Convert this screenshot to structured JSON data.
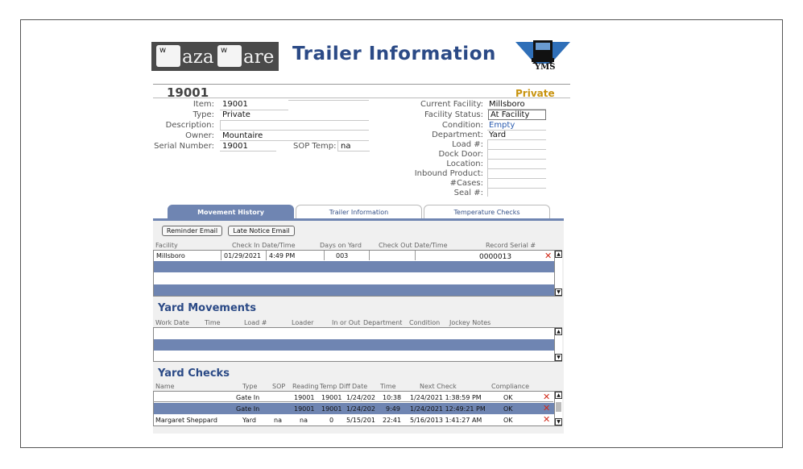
{
  "logo": {
    "key1": "w",
    "word1": "aza",
    "key2": "w",
    "word2": "are"
  },
  "header": {
    "title": "Trailer Information",
    "badge_text": "YMS"
  },
  "trailer": {
    "number": "19001",
    "category": "Private"
  },
  "left_fields": [
    {
      "label": "Item:",
      "value": "19001"
    },
    {
      "label": "Type:",
      "value": "Private"
    },
    {
      "label": "Description:",
      "value": ""
    },
    {
      "label": "Owner:",
      "value": "Mountaire"
    },
    {
      "label": "Serial Number:",
      "value": "19001"
    }
  ],
  "sop_temp": {
    "label": "SOP Temp:",
    "value": "na"
  },
  "right_fields": [
    {
      "label": "Current Facility:",
      "value": "Millsboro"
    },
    {
      "label": "Facility Status:",
      "value": "At Facility"
    },
    {
      "label": "Condition:",
      "value": "Empty"
    },
    {
      "label": "Department:",
      "value": "Yard"
    },
    {
      "label": "Load #:",
      "value": ""
    },
    {
      "label": "Dock Door:",
      "value": ""
    },
    {
      "label": "Location:",
      "value": ""
    },
    {
      "label": "Inbound Product:",
      "value": ""
    },
    {
      "label": "#Cases:",
      "value": ""
    },
    {
      "label": "Seal #:",
      "value": ""
    }
  ],
  "tabs": [
    {
      "label": "Movement History"
    },
    {
      "label": "Trailer Information"
    },
    {
      "label": "Temperature Checks"
    }
  ],
  "buttons": {
    "reminder": "Reminder Email",
    "late_notice": "Late Notice Email"
  },
  "movement_history": {
    "headers": [
      "Facility",
      "Check In Date/Time",
      "Days on Yard",
      "Check Out Date/Time",
      "Record Serial #"
    ],
    "rows": [
      {
        "facility": "Millsboro",
        "date": "01/29/2021",
        "time": "4:49 PM",
        "days": "003",
        "checkout": "",
        "serial": "0000013"
      }
    ]
  },
  "yard_movements": {
    "title": "Yard Movements",
    "headers": [
      "Work Date",
      "Time",
      "Load #",
      "Loader",
      "In or Out",
      "Department",
      "Condition",
      "Jockey Notes"
    ]
  },
  "yard_checks": {
    "title": "Yard Checks",
    "headers": [
      "Name",
      "Type",
      "SOP",
      "Reading",
      "Temp Diff",
      "Date",
      "Time",
      "Next Check",
      "Compliance"
    ],
    "rows": [
      {
        "name": "",
        "type": "Gate In",
        "sop": "",
        "reading": "19001",
        "diff": "19001",
        "date": "1/24/202",
        "time": "10:38",
        "next": "1/24/2021 1:38:59 PM",
        "compliance": "OK"
      },
      {
        "name": "",
        "type": "Gate In",
        "sop": "",
        "reading": "19001",
        "diff": "19001",
        "date": "1/24/202",
        "time": "9:49",
        "next": "1/24/2021 12:49:21 PM",
        "compliance": "OK"
      },
      {
        "name": "Margaret Sheppard",
        "type": "Yard",
        "sop": "na",
        "reading": "na",
        "diff": "0",
        "date": "5/15/201",
        "time": "22:41",
        "next": "5/16/2013 1:41:27 AM",
        "compliance": "OK"
      }
    ]
  },
  "colors": {
    "title": "#2b4a86",
    "band": "#6f85b2",
    "private": "#c8930e",
    "delete": "#d02a1a"
  },
  "icons": {
    "delete": "red-x-icon",
    "scroll_up": "arrow-up-icon",
    "scroll_down": "arrow-down-icon",
    "logo": "truck-logo-icon"
  }
}
